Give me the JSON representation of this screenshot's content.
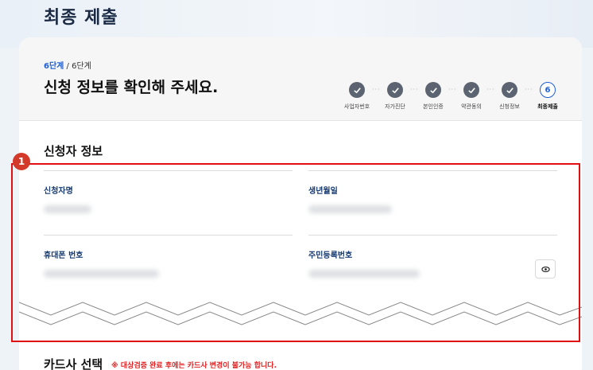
{
  "page": {
    "title": "최종 제출"
  },
  "header": {
    "step_current": "6단계",
    "step_total": " / 6단계",
    "title": "신청 정보를 확인해 주세요."
  },
  "stepper": {
    "steps": [
      {
        "label": "사업자번호",
        "done": true
      },
      {
        "label": "자가진단",
        "done": true
      },
      {
        "label": "본인인증",
        "done": true
      },
      {
        "label": "약관동의",
        "done": true
      },
      {
        "label": "신청정보",
        "done": true
      },
      {
        "label": "최종제출",
        "done": false,
        "number": "6"
      }
    ],
    "separator": "···"
  },
  "applicant": {
    "title": "신청자 정보",
    "fields": {
      "name_label": "신청자명",
      "birth_label": "생년월일",
      "phone_label": "휴대폰 번호",
      "rrn_label": "주민등록번호"
    }
  },
  "card_section": {
    "title": "카드사 선택",
    "note": "※ 대상검증 완료 후에는 카드사 변경이 불가능 합니다."
  },
  "annotation": {
    "badge": "1"
  },
  "colors": {
    "accent": "#1f5fd1",
    "step_done": "#5b6470",
    "highlight": "#e01010",
    "warning": "#e02020"
  }
}
